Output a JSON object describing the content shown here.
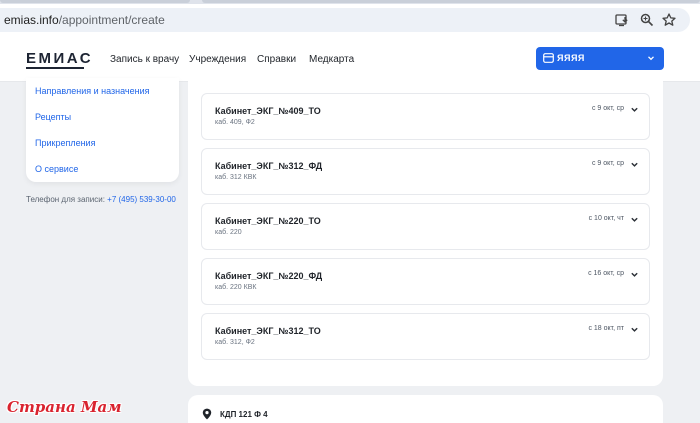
{
  "browser": {
    "url_host": "emias.info",
    "url_path": "/appointment/create",
    "icons": [
      "install-app-icon",
      "zoom-icon",
      "bookmark-star-icon"
    ]
  },
  "header": {
    "logo": "ЕМИАС",
    "nav": [
      {
        "label": "Запись к врачу",
        "active": true
      },
      {
        "label": "Учреждения",
        "active": false
      },
      {
        "label": "Справки",
        "active": false
      },
      {
        "label": "Медкарта",
        "active": false
      }
    ],
    "profile_label": "ЯЯЯЯ"
  },
  "sidebar": {
    "items": [
      {
        "label": "Направления и назначения"
      },
      {
        "label": "Рецепты"
      },
      {
        "label": "Прикрепления"
      },
      {
        "label": "О сервисе"
      }
    ],
    "phone_label": "Телефон для записи:",
    "phone_number": "+7 (495) 539-30-00"
  },
  "rooms": [
    {
      "title": "Кабинет_ЭКГ_№409_ТО",
      "sub": "каб. 409, Ф2",
      "date": "с 9 окт, ср"
    },
    {
      "title": "Кабинет_ЭКГ_№312_ФД",
      "sub": "каб. 312 КВК",
      "date": "с 9 окт, ср"
    },
    {
      "title": "Кабинет_ЭКГ_№220_ТО",
      "sub": "каб. 220",
      "date": "с 10 окт, чт"
    },
    {
      "title": "Кабинет_ЭКГ_№220_ФД",
      "sub": "каб. 220 КВК",
      "date": "с 16 окт, ср"
    },
    {
      "title": "Кабинет_ЭКГ_№312_ТО",
      "sub": "каб. 312, Ф2",
      "date": "с 18 окт, пт"
    }
  ],
  "location": {
    "label": "КДП 121 Ф 4"
  },
  "watermark": "Страна Мам",
  "colors": {
    "accent": "#2166e8",
    "watermark": "#d9232f",
    "background": "#eef0f3"
  }
}
